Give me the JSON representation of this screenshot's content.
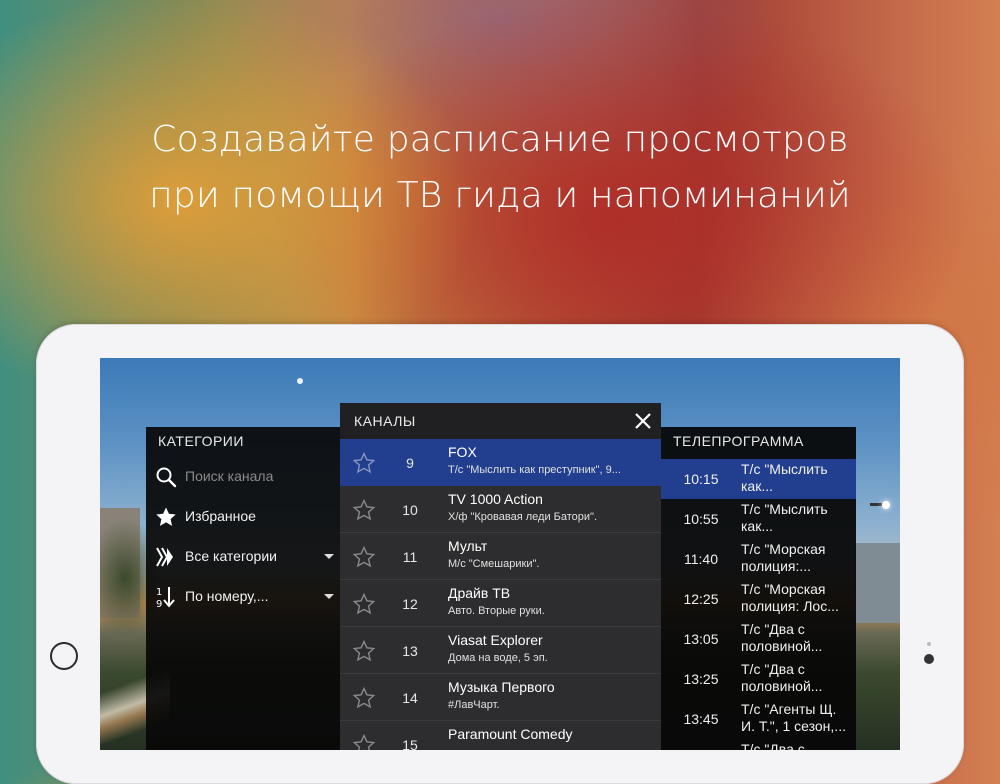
{
  "headline": {
    "line1": "Создавайте расписание просмотров",
    "line2": "при помощи ТВ гида и напоминаний"
  },
  "categories": {
    "title": "КАТЕГОРИИ",
    "search_placeholder": "Поиск канала",
    "favorites": "Избранное",
    "all_categories": "Все категории",
    "sort": "По номеру,..."
  },
  "channels": {
    "title": "КАНАЛЫ",
    "items": [
      {
        "num": "9",
        "name": "FOX",
        "prog": "Т/с \"Мыслить как преступник\", 9..."
      },
      {
        "num": "10",
        "name": "TV 1000 Action",
        "prog": "Х/ф \"Кровавая леди Батори\"."
      },
      {
        "num": "11",
        "name": "Мульт",
        "prog": "М/с \"Смешарики\"."
      },
      {
        "num": "12",
        "name": "Драйв ТВ",
        "prog": "Авто. Вторые руки."
      },
      {
        "num": "13",
        "name": "Viasat Explorer",
        "prog": "Дома на воде, 5 эп."
      },
      {
        "num": "14",
        "name": "Музыка Первого",
        "prog": "#ЛавЧарт."
      },
      {
        "num": "15",
        "name": "Paramount Comedy",
        "prog": ""
      }
    ]
  },
  "guide": {
    "title": "ТЕЛЕПРОГРАММА",
    "items": [
      {
        "time": "10:15",
        "desc": "Т/с \"Мыслить\nкак..."
      },
      {
        "time": "10:55",
        "desc": "Т/с \"Мыслить\nкак..."
      },
      {
        "time": "11:40",
        "desc": "Т/с \"Морская\nполиция:..."
      },
      {
        "time": "12:25",
        "desc": "Т/с \"Морская\nполиция: Лос..."
      },
      {
        "time": "13:05",
        "desc": "Т/с \"Два с\nполовиной..."
      },
      {
        "time": "13:25",
        "desc": "Т/с \"Два с\nполовиной..."
      },
      {
        "time": "13:45",
        "desc": "Т/с \"Агенты Щ.\nИ. Т.\", 1 сезон,..."
      },
      {
        "time": "",
        "desc": "Т/с \"Два с\n"
      }
    ]
  },
  "colors": {
    "selected": "#213f8e",
    "panel": "#2d2d2f"
  }
}
